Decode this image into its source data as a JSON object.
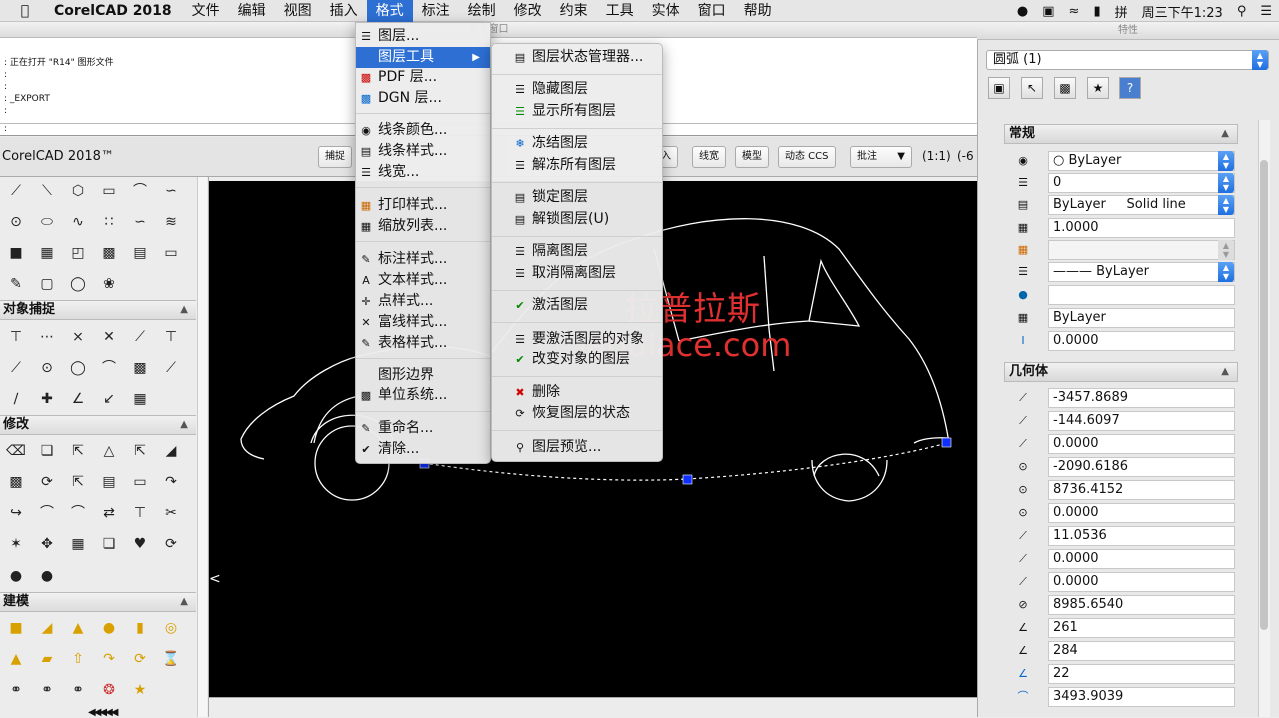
{
  "menubar": {
    "app_name": "CorelCAD 2018",
    "items": [
      "文件",
      "编辑",
      "视图",
      "插入",
      "格式",
      "标注",
      "绘制",
      "修改",
      "约束",
      "工具",
      "实体",
      "窗口",
      "帮助"
    ],
    "active_index": 4,
    "clock": "周三下午1:23"
  },
  "command_window": {
    "title": "命令窗口",
    "lines": [
      ": 正在打开 \"R14\" 图形文件",
      ":",
      ":",
      ": _EXPORT",
      ":"
    ],
    "prompt": ":"
  },
  "status_bar": {
    "app_version": "CorelCAD 2018™",
    "buttons": [
      "捕捉",
      "入",
      "线宽",
      "模型",
      "动态 CCS"
    ],
    "annotation_select": "批注",
    "scale": "(1:1)",
    "coord": "(-6"
  },
  "toolbox": {
    "sections": [
      {
        "title": "对象捕捉"
      },
      {
        "title": "修改"
      },
      {
        "title": "建模"
      }
    ]
  },
  "format_menu": {
    "items": [
      {
        "label": "图层...",
        "icon": "layers-icon"
      },
      {
        "label": "图层工具",
        "icon": "",
        "submenu": true
      },
      {
        "label": "PDF 层...",
        "icon": "pdf-icon"
      },
      {
        "label": "DGN 层...",
        "icon": "dgn-icon"
      },
      {
        "label": "线条颜色...",
        "icon": "color-palette-icon"
      },
      {
        "label": "线条样式...",
        "icon": "linestyle-icon"
      },
      {
        "label": "线宽...",
        "icon": "lineweight-icon"
      },
      {
        "label": "打印样式...",
        "icon": "print-style-icon"
      },
      {
        "label": "缩放列表...",
        "icon": "scale-list-icon"
      },
      {
        "label": "标注样式...",
        "icon": "dimension-style-icon"
      },
      {
        "label": "文本样式...",
        "icon": "text-style-icon"
      },
      {
        "label": "点样式...",
        "icon": "point-style-icon"
      },
      {
        "label": "富线样式...",
        "icon": "multiline-style-icon"
      },
      {
        "label": "表格样式...",
        "icon": "table-style-icon"
      },
      {
        "label": "图形边界",
        "icon": ""
      },
      {
        "label": "单位系统...",
        "icon": "units-icon"
      },
      {
        "label": "重命名...",
        "icon": "rename-icon"
      },
      {
        "label": "清除...",
        "icon": "purge-icon"
      }
    ]
  },
  "layer_tools_submenu": {
    "items": [
      {
        "label": "图层状态管理器...",
        "icon": "layer-state-icon"
      },
      {
        "label": "隐藏图层",
        "icon": "hide-layer-icon"
      },
      {
        "label": "显示所有图层",
        "icon": "show-layers-icon"
      },
      {
        "label": "冻结图层",
        "icon": "freeze-layer-icon"
      },
      {
        "label": "解冻所有图层",
        "icon": "thaw-layers-icon"
      },
      {
        "label": "锁定图层",
        "icon": "lock-layer-icon"
      },
      {
        "label": "解锁图层(U)",
        "icon": "unlock-layer-icon"
      },
      {
        "label": "隔离图层",
        "icon": "isolate-layer-icon"
      },
      {
        "label": "取消隔离图层",
        "icon": "unisolate-layer-icon"
      },
      {
        "label": "激活图层",
        "icon": "check-icon"
      },
      {
        "label": "要激活图层的对象",
        "icon": "activate-object-layer-icon"
      },
      {
        "label": "改变对象的图层",
        "icon": "change-layer-icon"
      },
      {
        "label": "删除",
        "icon": "delete-layer-icon"
      },
      {
        "label": "恢复图层的状态",
        "icon": "restore-layer-icon"
      },
      {
        "label": "图层预览...",
        "icon": "layer-preview-icon"
      }
    ]
  },
  "watermark": {
    "line1": "拉普拉斯",
    "line2": "lapulace.com"
  },
  "properties": {
    "title": "特性",
    "selection": "圆弧 (1)",
    "general_title": "常规",
    "general": [
      "○ ByLayer",
      "0",
      "ByLayer     Solid line",
      "1.0000",
      "",
      "——— ByLayer",
      "",
      "ByLayer",
      "0.0000"
    ],
    "geometry_title": "几何体",
    "geometry": [
      "-3457.8689",
      "-144.6097",
      "0.0000",
      "-2090.6186",
      "8736.4152",
      "0.0000",
      "11.0536",
      "0.0000",
      "0.0000",
      "8985.6540",
      "261",
      "284",
      "22",
      "3493.9039"
    ]
  },
  "colors": {
    "accent": "#2d6fd3",
    "watermark": "#e03030",
    "grip": "#1030ff"
  }
}
